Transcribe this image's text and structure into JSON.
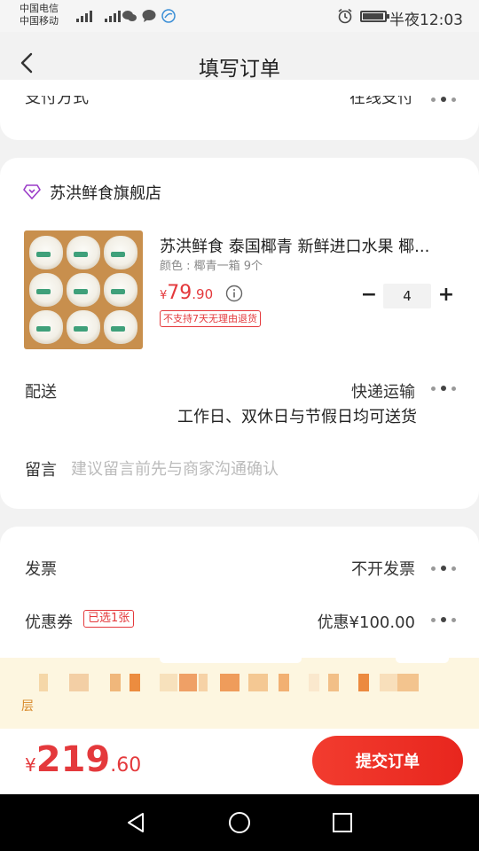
{
  "status_bar": {
    "carrier_1": "中国电信",
    "carrier_2": "中国移动",
    "net_1": "4G",
    "net_2": "2G",
    "time": "半夜12:03"
  },
  "header": {
    "title": "填写订单",
    "back_icon": "back-arrow-icon"
  },
  "payment": {
    "label": "支付方式",
    "value": "在线支付"
  },
  "store": {
    "name": "苏洪鲜食旗舰店"
  },
  "product": {
    "title": "苏洪鲜食 泰国椰青 新鲜进口水果 椰...",
    "spec": "颜色 : 椰青一箱 9个",
    "price_symbol": "¥",
    "price_main": "79",
    "price_decimal": ".90",
    "return_tag": "不支持7天无理由退货",
    "quantity": "4",
    "minus": "−",
    "plus": "+"
  },
  "delivery": {
    "label": "配送",
    "value": "快递运输",
    "note": "工作日、双休日与节假日均可送货"
  },
  "message": {
    "label": "留言",
    "placeholder": "建议留言前先与商家沟通确认"
  },
  "invoice": {
    "label": "发票",
    "value": "不开发票"
  },
  "coupon": {
    "label": "优惠券",
    "badge": "已选1张",
    "value": "优惠¥100.00"
  },
  "promo": {
    "tail_text": "层"
  },
  "footer": {
    "total_symbol": "¥",
    "total_main": "219",
    "total_decimal": ".60",
    "submit_label": "提交订单"
  },
  "colors": {
    "accent": "#e4393c",
    "background": "#f2f2f2",
    "promo_bg": "#fdf6e0"
  }
}
